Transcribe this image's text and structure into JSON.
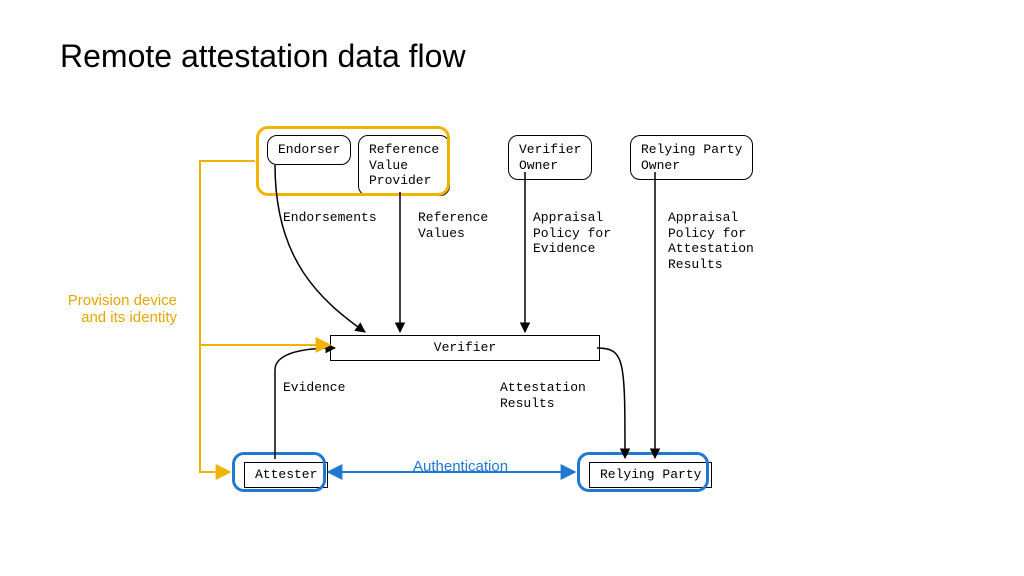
{
  "title": "Remote attestation data flow",
  "boxes": {
    "endorser": "Endorser",
    "refValueProvider": "Reference\nValue\nProvider",
    "verifierOwner": "Verifier\nOwner",
    "relyingPartyOwner": "Relying Party\nOwner",
    "verifier": "Verifier",
    "attester": "Attester",
    "relyingParty": "Relying Party"
  },
  "edges": {
    "endorsements": "Endorsements",
    "referenceValues": "Reference\nValues",
    "appraisalEvidence": "Appraisal\nPolicy for\nEvidence",
    "appraisalResults": "Appraisal\nPolicy for\nAttestation\nResults",
    "evidence": "Evidence",
    "attestationResults": "Attestation\nResults"
  },
  "captions": {
    "provision": "Provision device\nand its identity",
    "auth": "Authentication"
  },
  "colors": {
    "orange": "#f0b400",
    "blue": "#1f78d1"
  }
}
